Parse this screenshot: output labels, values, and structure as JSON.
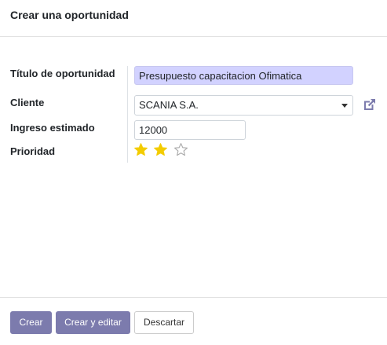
{
  "dialog": {
    "title": "Crear una oportunidad"
  },
  "form": {
    "title_label": "Título de oportunidad",
    "title_value": "Presupuesto capacitacion Ofimatica",
    "client_label": "Cliente",
    "client_value": "SCANIA S.A.",
    "revenue_label": "Ingreso estimado",
    "revenue_value": "12000",
    "priority_label": "Prioridad",
    "priority_filled": 2,
    "priority_total": 3
  },
  "footer": {
    "create_label": "Crear",
    "create_edit_label": "Crear y editar",
    "discard_label": "Descartar"
  },
  "colors": {
    "primary": "#7c7bad",
    "star_filled": "#f3cc00",
    "star_empty": "#a8a8a8",
    "link_icon": "#7c7bad",
    "title_input_bg": "#d2d2ff"
  },
  "icons": {
    "client_link": "external-link-icon",
    "select_caret": "chevron-down-icon",
    "priority": "star-icon"
  }
}
